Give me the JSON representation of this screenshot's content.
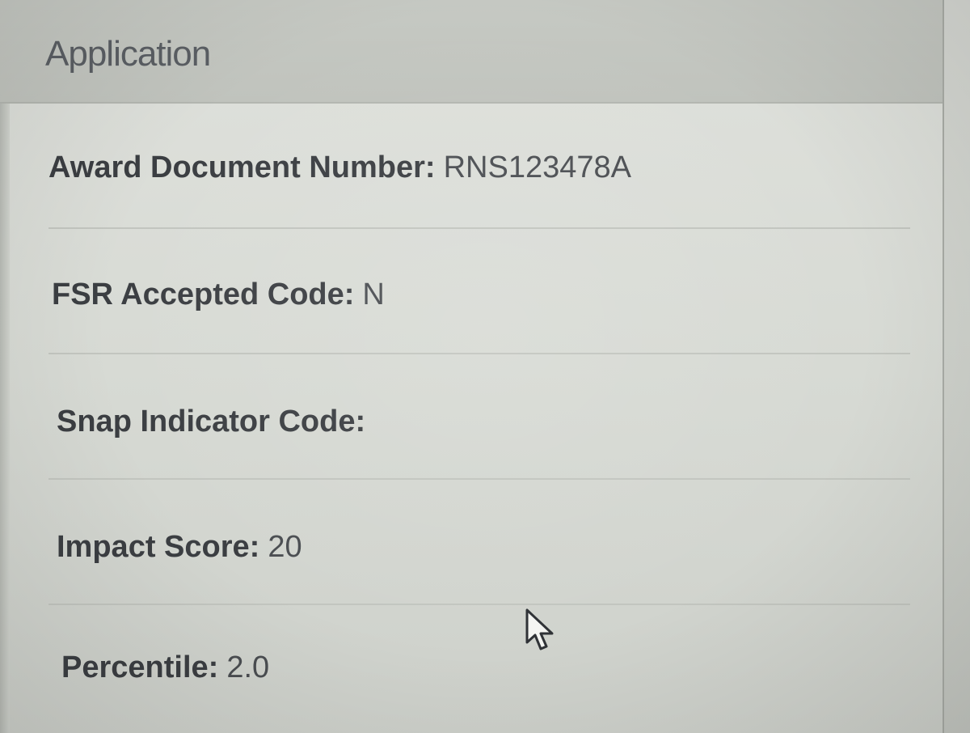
{
  "panel": {
    "title": "Application"
  },
  "fields": [
    {
      "label": "Award Document Number:",
      "value": "RNS123478A"
    },
    {
      "label": "FSR Accepted Code:",
      "value": "N"
    },
    {
      "label": "Snap Indicator Code:",
      "value": ""
    },
    {
      "label": "Impact Score:",
      "value": "20"
    },
    {
      "label": "Percentile:",
      "value": "2.0"
    }
  ],
  "icons": {
    "cursor": "mouse-pointer-icon"
  },
  "colors": {
    "background": "#d7dad4",
    "header": "#c3c6c0",
    "label_text": "#3b3e42",
    "title_text": "#5a5e63"
  }
}
